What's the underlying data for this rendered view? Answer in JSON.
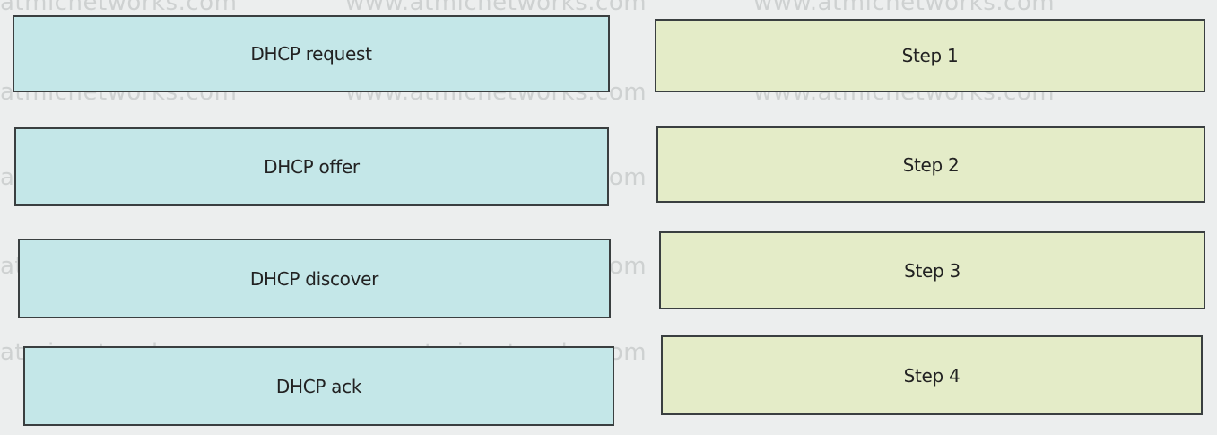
{
  "watermark_text": "www.atmicnetworks.com",
  "watermark_short": "atmicnetworks.com",
  "sources": [
    {
      "label": "DHCP request"
    },
    {
      "label": "DHCP offer"
    },
    {
      "label": "DHCP discover"
    },
    {
      "label": "DHCP ack"
    }
  ],
  "targets": [
    {
      "label": "Step 1"
    },
    {
      "label": "Step 2"
    },
    {
      "label": "Step 3"
    },
    {
      "label": "Step 4"
    }
  ]
}
